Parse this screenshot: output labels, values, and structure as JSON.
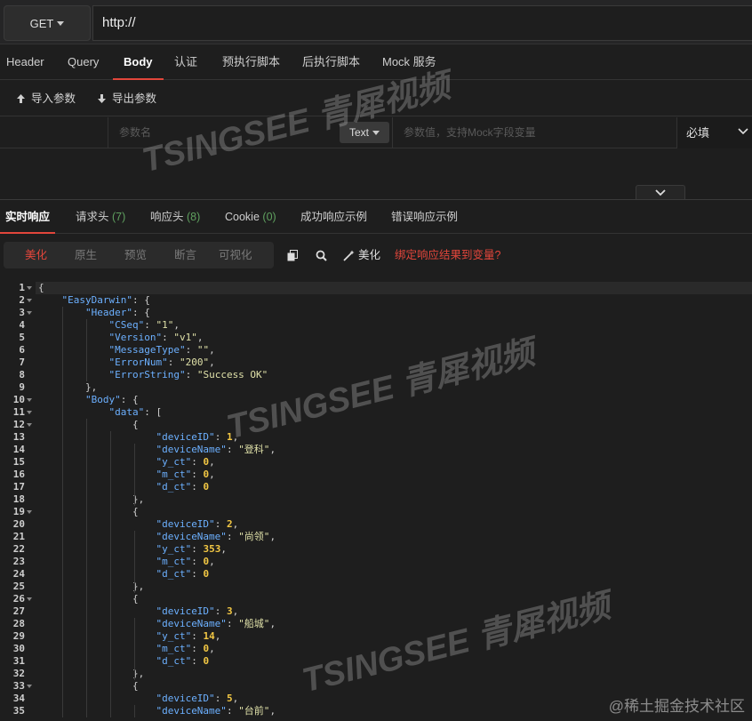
{
  "request": {
    "method": "GET",
    "url": "http://"
  },
  "request_tabs": [
    "Header",
    "Query",
    "Body",
    "认证",
    "预执行脚本",
    "后执行脚本",
    "Mock 服务"
  ],
  "params_bar": {
    "import_label": "导入参数",
    "export_label": "导出参数"
  },
  "param_row": {
    "name_placeholder": "参数名",
    "type_value": "Text",
    "value_placeholder": "参数值，支持Mock字段变量",
    "required_value": "必填"
  },
  "response_tabs": [
    {
      "label": "实时响应",
      "count": ""
    },
    {
      "label": "请求头",
      "count": "(7)"
    },
    {
      "label": "响应头",
      "count": "(8)"
    },
    {
      "label": "Cookie",
      "count": "(0)"
    },
    {
      "label": "成功响应示例",
      "count": ""
    },
    {
      "label": "错误响应示例",
      "count": ""
    }
  ],
  "view_tabs": [
    "美化",
    "原生",
    "预览",
    "断言",
    "可视化"
  ],
  "tools": {
    "beautify_label": "美化",
    "bind_label": "绑定响应结果到变量?"
  },
  "code_lines": [
    "{",
    "    \"EasyDarwin\": {",
    "        \"Header\": {",
    "            \"CSeq\": \"1\",",
    "            \"Version\": \"v1\",",
    "            \"MessageType\": \"\",",
    "            \"ErrorNum\": \"200\",",
    "            \"ErrorString\": \"Success OK\"",
    "        },",
    "        \"Body\": {",
    "            \"data\": [",
    "                {",
    "                    \"deviceID\": 1,",
    "                    \"deviceName\": \"登科\",",
    "                    \"y_ct\": 0,",
    "                    \"m_ct\": 0,",
    "                    \"d_ct\": 0",
    "                },",
    "                {",
    "                    \"deviceID\": 2,",
    "                    \"deviceName\": \"尚领\",",
    "                    \"y_ct\": 353,",
    "                    \"m_ct\": 0,",
    "                    \"d_ct\": 0",
    "                },",
    "                {",
    "                    \"deviceID\": 3,",
    "                    \"deviceName\": \"船城\",",
    "                    \"y_ct\": 14,",
    "                    \"m_ct\": 0,",
    "                    \"d_ct\": 0",
    "                },",
    "                {",
    "                    \"deviceID\": 5,",
    "                    \"deviceName\": \"台前\","
  ],
  "fold_lines": [
    1,
    2,
    3,
    10,
    11,
    12,
    19,
    26,
    33
  ],
  "watermark": {
    "brand": "TSINGSEE",
    "cn": "青犀视频"
  },
  "credit": "@稀土掘金技术社区"
}
